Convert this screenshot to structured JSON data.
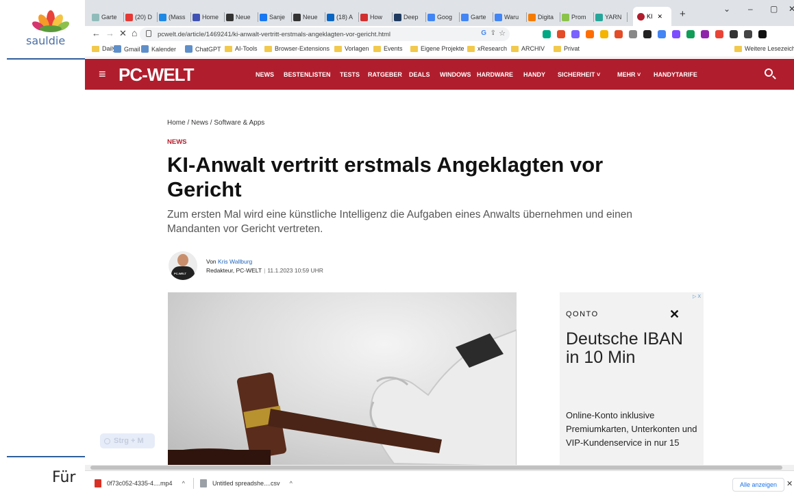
{
  "slide": {
    "logo_text": "sauldie",
    "footer_text": "Für"
  },
  "browser": {
    "tabs": [
      {
        "label": "Garte",
        "color": "#8fbcbb"
      },
      {
        "label": "(20) D",
        "color": "#e53935"
      },
      {
        "label": "(Mass",
        "color": "#1e88e5"
      },
      {
        "label": "Home",
        "color": "#3f51b5"
      },
      {
        "label": "Neue",
        "color": "#333333"
      },
      {
        "label": "Sanje",
        "color": "#1877f2"
      },
      {
        "label": "Neue",
        "color": "#333333"
      },
      {
        "label": "(18) A",
        "color": "#0a66c2"
      },
      {
        "label": "How",
        "color": "#d32f2f"
      },
      {
        "label": "Deep",
        "color": "#1e3a5f"
      },
      {
        "label": "Goog",
        "color": "#4285f4"
      },
      {
        "label": "Garte",
        "color": "#4285f4"
      },
      {
        "label": "Waru",
        "color": "#4285f4"
      },
      {
        "label": "Digita",
        "color": "#f57c00"
      },
      {
        "label": "Prom",
        "color": "#8bc34a"
      },
      {
        "label": "YARN",
        "color": "#26a69a"
      }
    ],
    "active_tab": {
      "label": "KI",
      "color": "#b01e2d"
    },
    "new_tab_glyph": "+",
    "url": "pcwelt.de/article/1469241/ki-anwalt-vertritt-erstmals-angeklagten-vor-gericht.html",
    "bookmarks": [
      {
        "label": "Daily",
        "type": "folder"
      },
      {
        "label": "Gmail",
        "type": "site"
      },
      {
        "label": "Kalender",
        "type": "site"
      },
      {
        "label": "ChatGPT",
        "type": "site"
      },
      {
        "label": "AI-Tools",
        "type": "folder"
      },
      {
        "label": "Browser-Extensions",
        "type": "folder"
      },
      {
        "label": "Vorlagen",
        "type": "folder"
      },
      {
        "label": "Events",
        "type": "folder"
      },
      {
        "label": "Eigene Projekte",
        "type": "folder"
      },
      {
        "label": "xResearch",
        "type": "folder"
      },
      {
        "label": "ARCHIV",
        "type": "folder"
      },
      {
        "label": "Privat",
        "type": "folder"
      }
    ],
    "other_bookmarks": "Weitere Lesezeichen"
  },
  "site": {
    "logo": "PC-WELT",
    "nav": [
      "NEWS",
      "BESTENLISTEN",
      "TESTS",
      "RATGEBER",
      "DEALS",
      "WINDOWS",
      "HARDWARE",
      "HANDY",
      "SICHERHEIT ˅",
      "MEHR ˅",
      "HANDYTARIFE"
    ],
    "brand_color": "#b01e2d"
  },
  "article": {
    "breadcrumb": "Home / News / Software & Apps",
    "category": "NEWS",
    "headline": "KI-Anwalt vertritt erstmals Angeklagten vor Gericht",
    "teaser": "Zum ersten Mal wird eine künstliche Intelligenz die Aufgaben eines Anwalts übernehmen und einen Mandanten vor Gericht vertreten.",
    "author_prefix": "Von",
    "author_name": "Kris Wallburg",
    "author_role": "Redakteur, PC-WELT",
    "separator": "|",
    "date": "11.1.2023 10:59 UHR",
    "avatar_text": "PC-WELT"
  },
  "ad": {
    "badge": "▷ X",
    "brand": "QONTO",
    "headline": "Deutsche IBAN in 10 Min",
    "body": "Online-Konto inklusive Premiumkarten, Unterkonten und VIP-Kundenservice in nur 15"
  },
  "overlay": {
    "shortcut": "Strg + M"
  },
  "downloads": {
    "items": [
      {
        "name": "0f73c052-4335-4....mp4",
        "color": "#d93025"
      },
      {
        "name": "Untitled spreadshe....csv",
        "color": "#9aa0a6"
      }
    ],
    "show_all": "Alle anzeigen",
    "close": "✕"
  }
}
